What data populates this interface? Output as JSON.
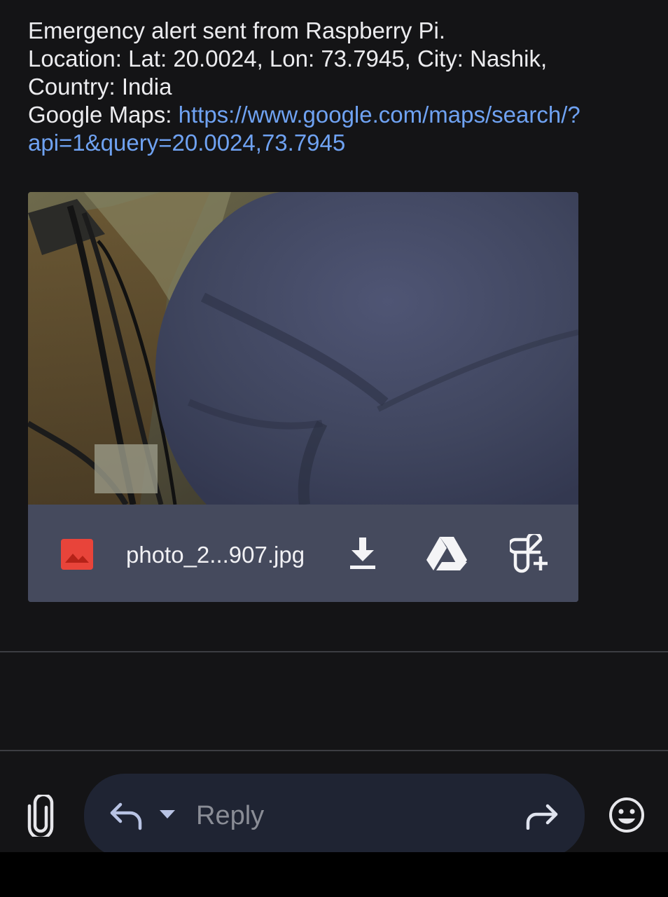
{
  "message": {
    "line1": "Emergency alert sent from Raspberry Pi.",
    "line2": "Location: Lat: 20.0024, Lon: 73.7945, City: Nashik,",
    "line3": "Country: India",
    "maps_label": "Google Maps: ",
    "maps_link_part1": "https://www.google.com/maps/search/?",
    "maps_link_part2": "api=1&query=20.0024,73.7945"
  },
  "attachment": {
    "file_name": "photo_2...907.jpg",
    "file_icon": "image-file-icon",
    "actions": [
      "download-icon",
      "google-drive-icon",
      "add-to-photos-icon"
    ]
  },
  "compose": {
    "attach_icon": "paperclip-icon",
    "reply_icon": "reply-icon",
    "reply_caret_icon": "chevron-down-icon",
    "placeholder": "Reply",
    "forward_icon": "forward-icon",
    "emoji_icon": "emoji-icon"
  },
  "colors": {
    "background": "#141416",
    "link": "#6fa2f2",
    "attachment_bar": "#454a5d",
    "file_icon_red": "#e8443a",
    "reply_box": "#1f2433"
  }
}
